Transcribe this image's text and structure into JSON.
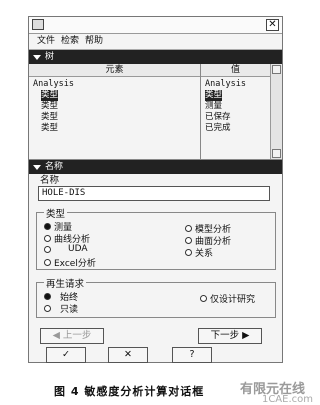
{
  "window": {
    "close_glyph": "✕"
  },
  "menu": [
    "文件",
    "检索",
    "帮助"
  ],
  "tree_section": {
    "title": "树"
  },
  "tree": {
    "elements_header": "元素",
    "values_header": "值",
    "element_rows": [
      "Analysis",
      "类型",
      "类型",
      "类型",
      "类型"
    ],
    "value_rows": [
      "Analysis",
      "类型",
      "测量",
      "已保存",
      "已完成"
    ],
    "selected_index": 1
  },
  "name_section": {
    "title": "名称"
  },
  "name": {
    "label": "名称",
    "value": "HOLE-DIS"
  },
  "type_group": {
    "label": "类型",
    "options_left": [
      "测量",
      "曲线分析",
      "UDA",
      "Excel分析"
    ],
    "options_right": [
      "模型分析",
      "曲面分析",
      "关系"
    ],
    "selected": "测量"
  },
  "request_group": {
    "label": "再生请求",
    "options": [
      "始终",
      "只读",
      "仅设计研究"
    ],
    "selected": "始终"
  },
  "nav": {
    "prev": "◀ 上一步",
    "next": "下一步 ▶"
  },
  "actions": {
    "ok": "✓",
    "cancel": "✕",
    "help": "?"
  },
  "caption": "图 4  敏感度分析计算对话框",
  "watermark": {
    "line1": "有限元在线",
    "line2": "1CAE.com"
  }
}
